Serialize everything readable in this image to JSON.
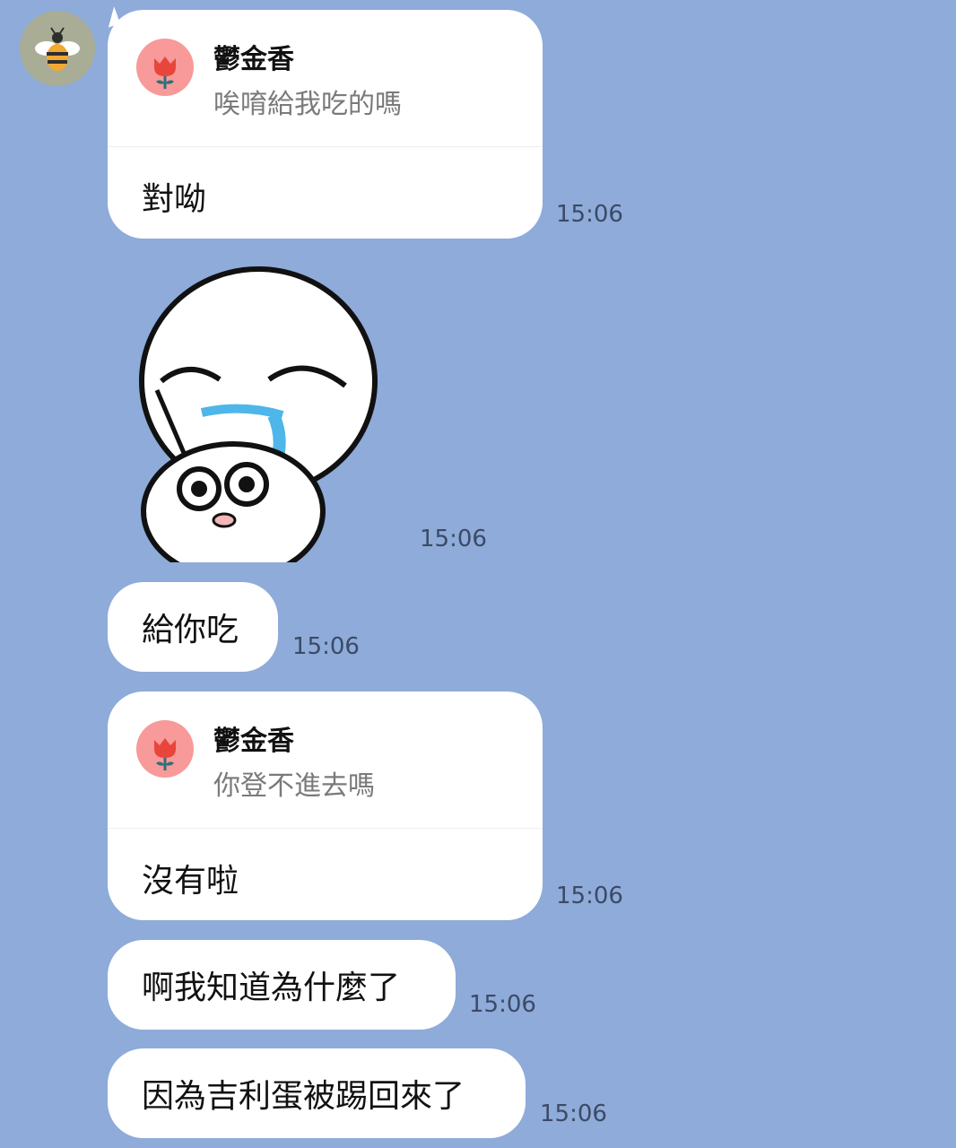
{
  "contact": {
    "avatar_icon": "bee-icon"
  },
  "messages": [
    {
      "type": "reply",
      "reply_to": {
        "name": "鬱金香",
        "quote": "唉唷給我吃的嗎",
        "icon": "tulip-icon"
      },
      "text": "對呦",
      "time": "15:06"
    },
    {
      "type": "sticker",
      "sticker": "crying-bun-sticker",
      "time": "15:06"
    },
    {
      "type": "text",
      "text": "給你吃",
      "time": "15:06"
    },
    {
      "type": "reply",
      "reply_to": {
        "name": "鬱金香",
        "quote": "你登不進去嗎",
        "icon": "tulip-icon"
      },
      "text": "沒有啦",
      "time": "15:06"
    },
    {
      "type": "text",
      "text": "啊我知道為什麼了",
      "time": "15:06"
    },
    {
      "type": "text",
      "text": "因為吉利蛋被踢回來了",
      "time": "15:06"
    }
  ],
  "colors": {
    "background": "#8eabd9",
    "bubble": "#ffffff",
    "reply_icon_bg": "#f79a99"
  }
}
